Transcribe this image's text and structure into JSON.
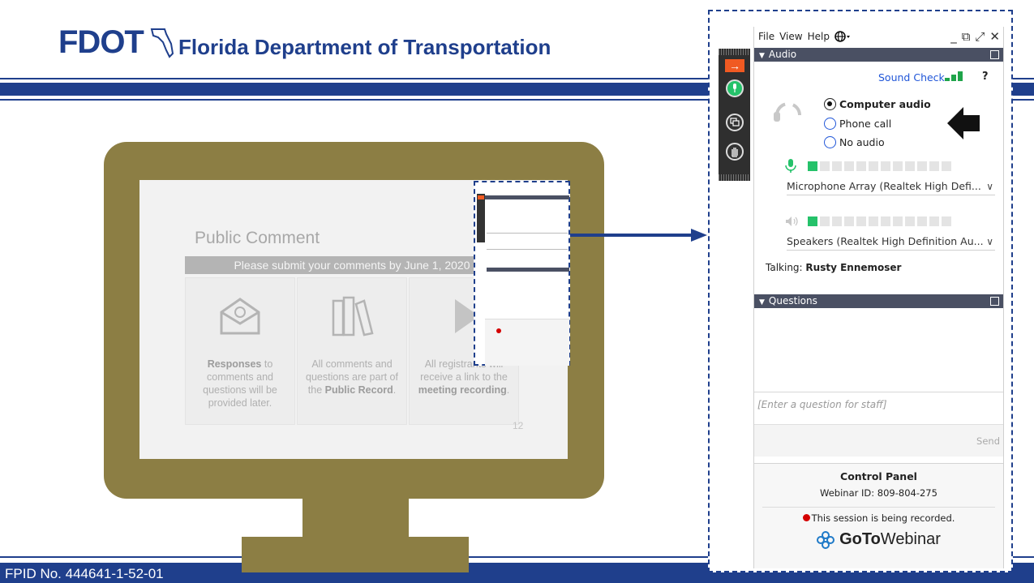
{
  "slide": {
    "logo": "FDOT",
    "title": "Florida Department of Transportation",
    "footer": "FPID No. 444641-1-52-01"
  },
  "screen": {
    "title": "Public Comment",
    "banner": "Please submit your comments by June 1, 2020",
    "cards": [
      {
        "icon": "envelope-icon",
        "bold": "Responses",
        "text_after": " to comments and questions will be provided later."
      },
      {
        "icon": "books-icon",
        "text_before": "All comments and questions are part of the ",
        "bold": "Public Record",
        "text_after": "."
      },
      {
        "icon": "play-icon",
        "text_before": "All registrants will receive a link to the ",
        "bold": "meeting recording",
        "text_after": "."
      }
    ],
    "page_number": "12"
  },
  "panel": {
    "menu": [
      "File",
      "View",
      "Help"
    ],
    "globe_icon": "globe-icon",
    "window_controls": [
      "_",
      "⧉",
      "⤢",
      "✕"
    ],
    "audio_header": "Audio",
    "sound_check": "Sound Check",
    "help": "?",
    "audio_options": [
      "Computer audio",
      "Phone call",
      "No audio"
    ],
    "selected_audio": "Computer audio",
    "mic_level_on": 1,
    "mic_level_total": 12,
    "speaker_level_on": 1,
    "speaker_level_total": 12,
    "microphone": "Microphone Array (Realtek High Defi...",
    "speakers": "Speakers (Realtek High Definition Au...",
    "talking_label": "Talking:",
    "talking_name": "Rusty Ennemoser",
    "questions_header": "Questions",
    "question_placeholder": "[Enter a question for staff]",
    "send": "Send",
    "control_panel": "Control Panel",
    "webinar_id": "Webinar ID: 809-804-275",
    "recording": "This session is being recorded.",
    "brand_goto": "GoTo",
    "brand_webinar": "Webinar"
  },
  "colors": {
    "brand_blue": "#1f3f8c",
    "monitor": "#8c7e44",
    "accent_green": "#25c26a",
    "recording_red": "#d40000",
    "sidebar_orange": "#f05a22"
  }
}
